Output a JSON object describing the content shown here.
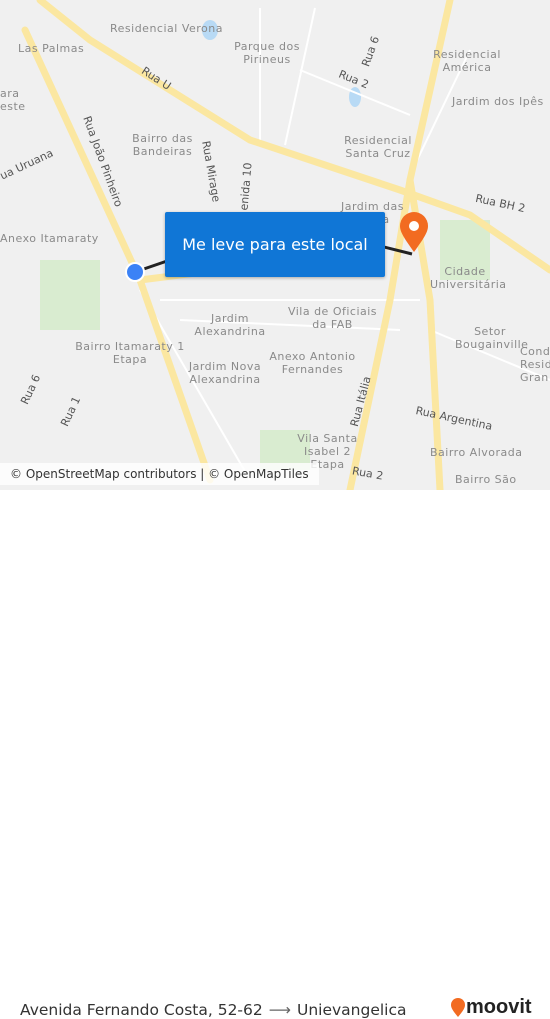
{
  "map": {
    "neighborhoods": [
      "Residencial Verona",
      "Las Palmas",
      "Parque dos Pirineus",
      "Residencial América",
      "Jardim dos Ipês",
      "Bairro das Bandeiras",
      "Residencial Santa Cruz",
      "Jardim das Etapa",
      "Anexo Itamaraty",
      "Cidade Universitária",
      "Vila de Oficiais da FAB",
      "Jardim Alexandrina",
      "Setor Bougainville",
      "Bairro Itamaraty 1 Etapa",
      "Jardim Nova Alexandrina",
      "Anexo Antonio Fernandes",
      "Vila Santa Isabel 2 Etapa",
      "Bairro Alvorada",
      "Bairro São",
      "ara",
      "este",
      "Cond",
      "Resid",
      "Gran"
    ],
    "streets": [
      "Rua U",
      "Rua 6",
      "Rua 2",
      "Rua BH 2",
      "Rua João Pinheiro",
      "Rua Mirage",
      "enida 10",
      "ua Uruana",
      "Rua Itália",
      "Rua Argentina",
      "Rua 6",
      "Rua 1",
      "Rua 2"
    ],
    "cta": "Me leve para este local",
    "attribution": "© OpenStreetMap contributors | © OpenMapTiles",
    "origin_color": "#3b82f6",
    "destination_color": "#f26b21",
    "road_color": "#fbe7a1"
  },
  "footer": {
    "origin": "Avenida Fernando Costa, 52-62",
    "destination": "Unievangelica",
    "brand": "moovit"
  }
}
